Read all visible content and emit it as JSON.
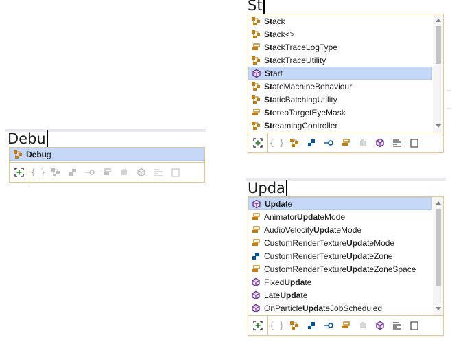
{
  "debug_popup": {
    "typed_text": "Debu",
    "items": [
      {
        "icon": "class-icon",
        "bold": "Debu",
        "rest": "g",
        "selected": true
      }
    ]
  },
  "start_popup": {
    "typed_text": "St",
    "items": [
      {
        "icon": "class-icon",
        "bold": "St",
        "rest": "ack",
        "selected": false
      },
      {
        "icon": "class-icon",
        "bold": "St",
        "rest": "ack<>",
        "selected": false
      },
      {
        "icon": "enum-icon",
        "bold": "St",
        "rest": "ackTraceLogType",
        "selected": false
      },
      {
        "icon": "class-icon",
        "bold": "St",
        "rest": "ackTraceUtility",
        "selected": false
      },
      {
        "icon": "method-icon",
        "bold": "St",
        "rest": "art",
        "selected": true
      },
      {
        "icon": "class-icon",
        "bold": "St",
        "rest": "ateMachineBehaviour",
        "selected": false
      },
      {
        "icon": "class-icon",
        "bold": "St",
        "rest": "aticBatchingUtility",
        "selected": false
      },
      {
        "icon": "enum-icon",
        "bold": "St",
        "rest": "ereoTargetEyeMask",
        "selected": false
      },
      {
        "icon": "class-icon",
        "bold": "St",
        "rest": "reamingController",
        "selected": false
      }
    ]
  },
  "update_popup": {
    "typed_text": "Upda",
    "items": [
      {
        "icon": "method-icon",
        "pre": "",
        "bold": "Upda",
        "rest": "te",
        "selected": true
      },
      {
        "icon": "enum-icon",
        "pre": "Animator",
        "bold": "Upda",
        "rest": "teMode",
        "selected": false
      },
      {
        "icon": "enum-icon",
        "pre": "AudioVelocity",
        "bold": "Upda",
        "rest": "teMode",
        "selected": false
      },
      {
        "icon": "enum-icon",
        "pre": "CustomRenderTexture",
        "bold": "Upda",
        "rest": "teMode",
        "selected": false
      },
      {
        "icon": "struct-icon",
        "pre": "CustomRenderTexture",
        "bold": "Upda",
        "rest": "teZone",
        "selected": false
      },
      {
        "icon": "enum-icon",
        "pre": "CustomRenderTexture",
        "bold": "Upda",
        "rest": "teZoneSpace",
        "selected": false
      },
      {
        "icon": "method-icon",
        "pre": "Fixed",
        "bold": "Upda",
        "rest": "te",
        "selected": false
      },
      {
        "icon": "method-icon",
        "pre": "Late",
        "bold": "Upda",
        "rest": "te",
        "selected": false
      },
      {
        "icon": "method-icon",
        "pre": "OnParticle",
        "bold": "Upda",
        "rest": "teJobScheduled",
        "selected": false
      }
    ]
  },
  "toolbar_filters": [
    {
      "name": "namespace-filter",
      "glyph": "{ }"
    },
    {
      "name": "class-filter",
      "glyph": "class"
    },
    {
      "name": "struct-filter",
      "glyph": "struct"
    },
    {
      "name": "interface-filter",
      "glyph": "interface"
    },
    {
      "name": "enum-filter",
      "glyph": "enum"
    },
    {
      "name": "delegate-filter",
      "glyph": "delegate"
    },
    {
      "name": "method-filter",
      "glyph": "method"
    },
    {
      "name": "keyword-filter",
      "glyph": "keyword"
    },
    {
      "name": "snippet-filter",
      "glyph": "snippet"
    }
  ],
  "colors": {
    "border": "#e4c88a",
    "selection": "#c5d8f7",
    "class": "#c27d0e",
    "method": "#652d90",
    "struct": "#00539c"
  }
}
